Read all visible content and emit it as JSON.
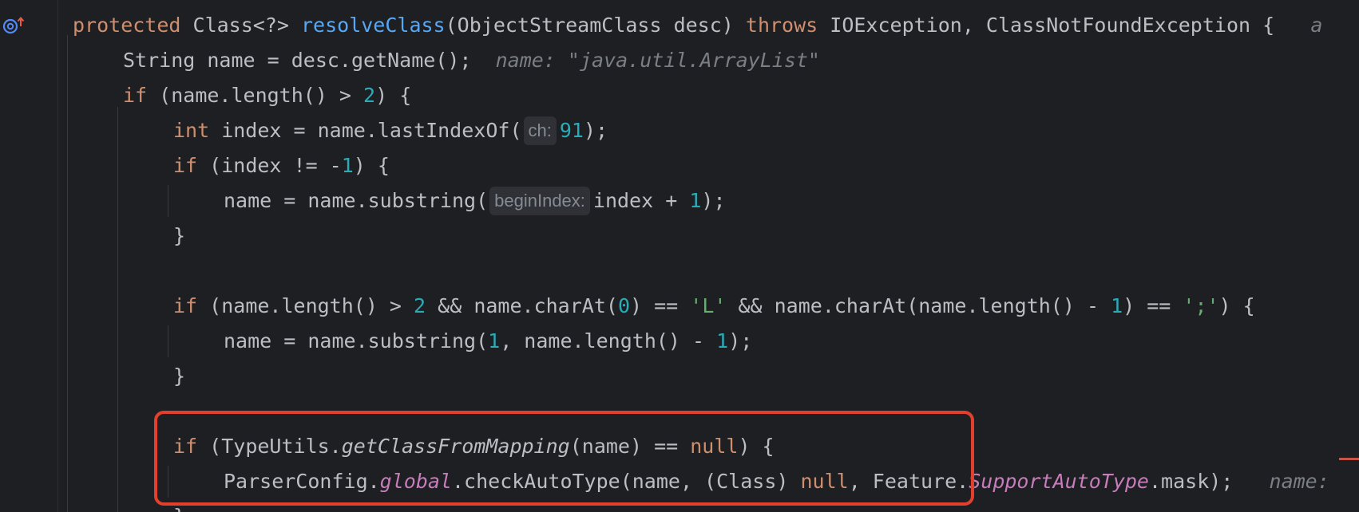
{
  "editor": {
    "lines": [
      {
        "tokens": [
          {
            "t": "protected",
            "c": "kw"
          },
          {
            "t": " Class<?> "
          },
          {
            "t": "resolveClass",
            "c": "fn"
          },
          {
            "t": "(ObjectStreamClass desc) "
          },
          {
            "t": "throws",
            "c": "kw"
          },
          {
            "t": " IOException, ClassNotFoundException {"
          },
          {
            "t": "   a",
            "c": "hint"
          }
        ]
      },
      {
        "tokens": [
          {
            "t": "String name = desc.getName();"
          },
          {
            "t": "  name: \"java.util.ArrayList\"",
            "c": "hint"
          }
        ]
      },
      {
        "tokens": [
          {
            "t": "if",
            "c": "kw"
          },
          {
            "t": " (name.length() > "
          },
          {
            "t": "2",
            "c": "num"
          },
          {
            "t": ") {"
          }
        ]
      },
      {
        "tokens": [
          {
            "t": "int",
            "c": "kw"
          },
          {
            "t": " index = name.lastIndexOf("
          },
          {
            "t": "ch:",
            "c": "inlay"
          },
          {
            "t": "91",
            "c": "num"
          },
          {
            "t": ");"
          }
        ]
      },
      {
        "tokens": [
          {
            "t": "if",
            "c": "kw"
          },
          {
            "t": " (index != -"
          },
          {
            "t": "1",
            "c": "num"
          },
          {
            "t": ") {"
          }
        ]
      },
      {
        "tokens": [
          {
            "t": "name = name.substring("
          },
          {
            "t": "beginIndex:",
            "c": "inlay"
          },
          {
            "t": "index + "
          },
          {
            "t": "1",
            "c": "num"
          },
          {
            "t": ");"
          }
        ]
      },
      {
        "tokens": [
          {
            "t": "}"
          }
        ]
      },
      {
        "tokens": [
          {
            "t": "if",
            "c": "kw"
          },
          {
            "t": " (name.length() > "
          },
          {
            "t": "2",
            "c": "num"
          },
          {
            "t": " && name.charAt("
          },
          {
            "t": "0",
            "c": "num"
          },
          {
            "t": ") == "
          },
          {
            "t": "'L'",
            "c": "str"
          },
          {
            "t": " && name.charAt(name.length() - "
          },
          {
            "t": "1",
            "c": "num"
          },
          {
            "t": ") == "
          },
          {
            "t": "';'",
            "c": "str"
          },
          {
            "t": ") {"
          }
        ]
      },
      {
        "tokens": [
          {
            "t": "name = name.substring("
          },
          {
            "t": "1",
            "c": "num"
          },
          {
            "t": ", name.length() - "
          },
          {
            "t": "1",
            "c": "num"
          },
          {
            "t": ");"
          }
        ]
      },
      {
        "tokens": [
          {
            "t": "}"
          }
        ]
      },
      {
        "tokens": [
          {
            "t": "if",
            "c": "kw"
          },
          {
            "t": " (TypeUtils."
          },
          {
            "t": "getClassFromMapping",
            "c": "ital"
          },
          {
            "t": "(name) == "
          },
          {
            "t": "null",
            "c": "kw"
          },
          {
            "t": ") {"
          }
        ]
      },
      {
        "tokens": [
          {
            "t": "ParserConfig."
          },
          {
            "t": "global",
            "c": "field"
          },
          {
            "t": ".checkAutoType(name, (Class) "
          },
          {
            "t": "null",
            "c": "kw"
          },
          {
            "t": ", Feature."
          },
          {
            "t": "SupportAutoType",
            "c": "field"
          },
          {
            "t": ".mask);"
          },
          {
            "t": "   name:",
            "c": "hint"
          }
        ]
      },
      {
        "tokens": [
          {
            "t": "}"
          }
        ]
      }
    ]
  },
  "colors": {
    "background": "#1e1f22",
    "keyword": "#cf8e6d",
    "method": "#56a8f5",
    "number": "#2aacb8",
    "string": "#6aab73",
    "static_field": "#c77dbb",
    "highlight_box": "#e2402c"
  },
  "icons": {
    "gutter": "override-method-icon"
  }
}
